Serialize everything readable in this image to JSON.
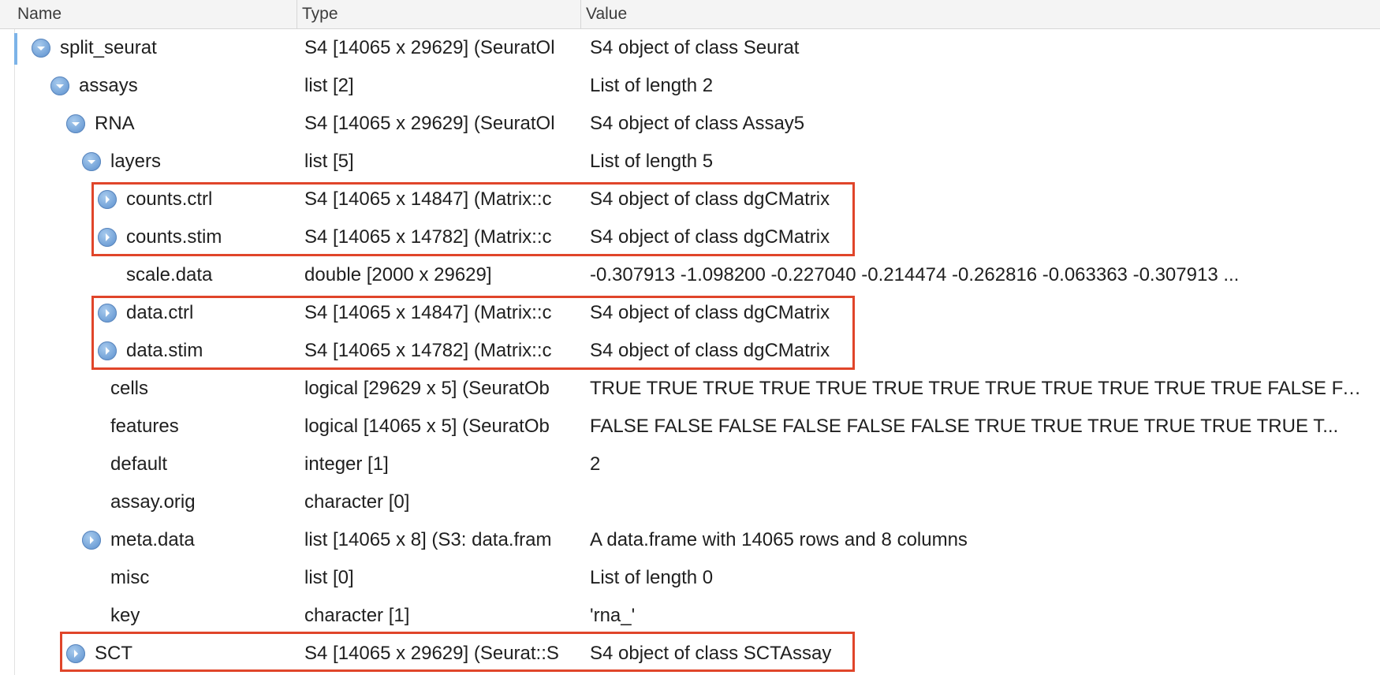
{
  "header": {
    "name": "Name",
    "type": "Type",
    "value": "Value"
  },
  "rows": [
    {
      "name": "split_seurat",
      "type": "S4 [14065 x 29629] (SeuratOl",
      "value": "S4 object of class Seurat",
      "toggle": "expanded-icon"
    },
    {
      "name": "assays",
      "type": "list [2]",
      "value": "List of length 2",
      "toggle": "expanded-icon"
    },
    {
      "name": "RNA",
      "type": "S4 [14065 x 29629] (SeuratOl",
      "value": "S4 object of class Assay5",
      "toggle": "expanded-icon"
    },
    {
      "name": "layers",
      "type": "list [5]",
      "value": "List of length 5",
      "toggle": "expanded-icon"
    },
    {
      "name": "counts.ctrl",
      "type": "S4 [14065 x 14847] (Matrix::c",
      "value": "S4 object of class dgCMatrix",
      "toggle": "collapsed-icon"
    },
    {
      "name": "counts.stim",
      "type": "S4 [14065 x 14782] (Matrix::c",
      "value": "S4 object of class dgCMatrix",
      "toggle": "collapsed-icon"
    },
    {
      "name": "scale.data",
      "type": "double [2000 x 29629]",
      "value": "-0.307913 -1.098200 -0.227040 -0.214474 -0.262816 -0.063363 -0.307913 ...",
      "toggle": ""
    },
    {
      "name": "data.ctrl",
      "type": "S4 [14065 x 14847] (Matrix::c",
      "value": "S4 object of class dgCMatrix",
      "toggle": "collapsed-icon"
    },
    {
      "name": "data.stim",
      "type": "S4 [14065 x 14782] (Matrix::c",
      "value": "S4 object of class dgCMatrix",
      "toggle": "collapsed-icon"
    },
    {
      "name": "cells",
      "type": "logical [29629 x 5] (SeuratOb",
      "value": "TRUE TRUE TRUE TRUE TRUE TRUE TRUE TRUE TRUE TRUE TRUE TRUE FALSE FALSE...",
      "toggle": ""
    },
    {
      "name": "features",
      "type": "logical [14065 x 5] (SeuratOb",
      "value": "FALSE FALSE FALSE FALSE FALSE FALSE TRUE TRUE TRUE TRUE TRUE TRUE T...",
      "toggle": ""
    },
    {
      "name": "default",
      "type": "integer [1]",
      "value": "2",
      "toggle": ""
    },
    {
      "name": "assay.orig",
      "type": "character [0]",
      "value": "",
      "toggle": ""
    },
    {
      "name": "meta.data",
      "type": "list [14065 x 8] (S3: data.fram",
      "value": "A data.frame with 14065 rows and 8 columns",
      "toggle": "collapsed-icon"
    },
    {
      "name": "misc",
      "type": "list [0]",
      "value": "List of length 0",
      "toggle": ""
    },
    {
      "name": "key",
      "type": "character [1]",
      "value": "'rna_'",
      "toggle": ""
    },
    {
      "name": "SCT",
      "type": "S4 [14065 x 29629] (Seurat::S",
      "value": "S4 object of class SCTAssay",
      "toggle": "collapsed-icon"
    }
  ],
  "colors": {
    "highlight": "#e0452a",
    "toggle": "#6f9fd6",
    "focus": "#7cb3e8"
  }
}
